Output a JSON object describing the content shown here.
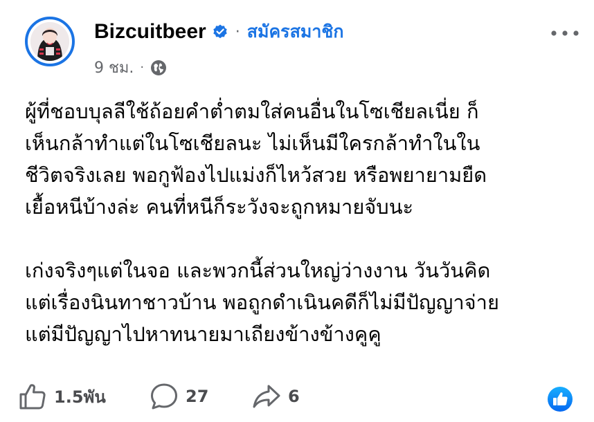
{
  "post": {
    "author": "Bizcuitbeer",
    "follow_label": "สมัครสมาชิก",
    "separator": "·",
    "time": "9 ชม.",
    "meta_separator": "·",
    "lines": [
      "ผู้ที่ชอบบุลลีใช้ถ้อยคำต่ำตมใส่คนอื่นในโซเชียลเนี่ย ก็",
      "เห็นกล้าทำแต่ในโซเชียลนะ ไม่เห็นมีใครกล้าทำในใน",
      "ชีวิตจริงเลย พอกูฟ้องไปแม่งก็ไหว้สวย หรือพยายามยืด",
      "เยื้อหนีบ้างล่ะ คนที่หนีก็ระวังจะถูกหมายจับนะ",
      "",
      "เก่งจริงๆแต่ในจอ และพวกนี้ส่วนใหญ่ว่างงาน วันวันคิด",
      "แต่เรื่องนินทาชาวบ้าน พอถูกดำเนินคดีก็ไม่มีปัญญาจ่าย",
      "แต่มีปัญญาไปหาทนายมาเถียงข้างข้างคูคู"
    ]
  },
  "actions": {
    "likes": "1.5พัน",
    "comments": "27",
    "shares": "6"
  },
  "icons": {
    "verified": "verified-badge-icon",
    "globe": "globe-icon",
    "more": "more-options-icon",
    "like": "thumbs-up-icon",
    "comment": "comment-icon",
    "share": "share-icon",
    "like_fab": "like-reaction-icon"
  },
  "colors": {
    "brand_blue": "#1b74e4",
    "text": "#050505",
    "secondary_text": "#65676b"
  }
}
